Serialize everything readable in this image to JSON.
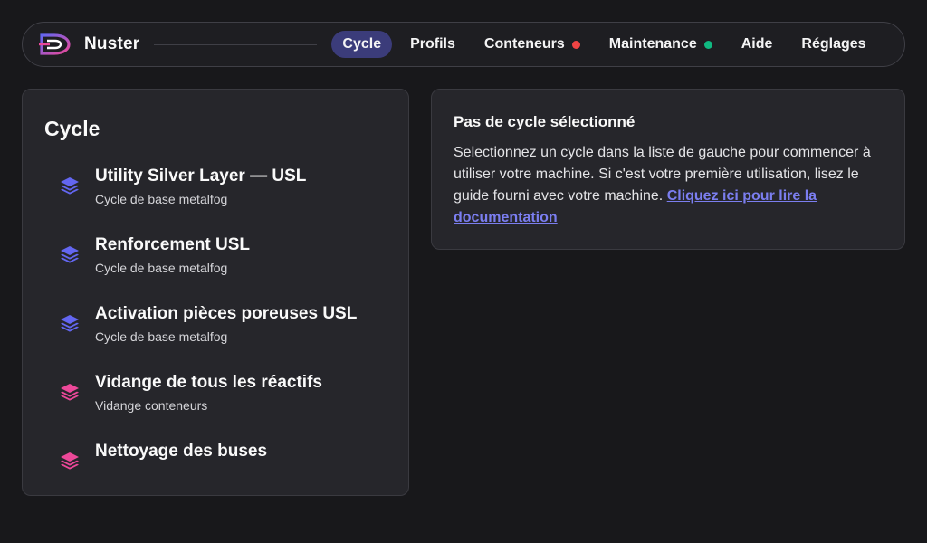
{
  "app": {
    "name": "Nuster"
  },
  "nav": {
    "items": [
      {
        "label": "Cycle",
        "active": true
      },
      {
        "label": "Profils"
      },
      {
        "label": "Conteneurs",
        "status": "red"
      },
      {
        "label": "Maintenance",
        "status": "green"
      },
      {
        "label": "Aide"
      },
      {
        "label": "Réglages"
      }
    ]
  },
  "cycles": {
    "title": "Cycle",
    "items": [
      {
        "name": "Utility Silver Layer — USL",
        "subtitle": "Cycle de base metalfog",
        "icon": "layers-icon",
        "color": "#6366f1"
      },
      {
        "name": "Renforcement USL",
        "subtitle": "Cycle de base metalfog",
        "icon": "layers-icon",
        "color": "#6366f1"
      },
      {
        "name": "Activation pièces poreuses USL",
        "subtitle": "Cycle de base metalfog",
        "icon": "layers-icon",
        "color": "#6366f1"
      },
      {
        "name": "Vidange de tous les réactifs",
        "subtitle": "Vidange conteneurs",
        "icon": "layers-icon",
        "color": "#ec4899"
      },
      {
        "name": "Nettoyage des buses",
        "subtitle": "",
        "icon": "layers-icon",
        "color": "#ec4899"
      }
    ]
  },
  "info": {
    "title": "Pas de cycle sélectionné",
    "body": "Selectionnez un cycle dans la liste de gauche pour commencer à utiliser votre machine. Si c'est votre première utilisation, lisez le guide fourni avec votre machine. ",
    "link": "Cliquez ici pour lire la documentation"
  },
  "colors": {
    "accent": "#3b3c7a",
    "link": "#7b7ef0",
    "status_red": "#ef4444",
    "status_green": "#10b981"
  }
}
